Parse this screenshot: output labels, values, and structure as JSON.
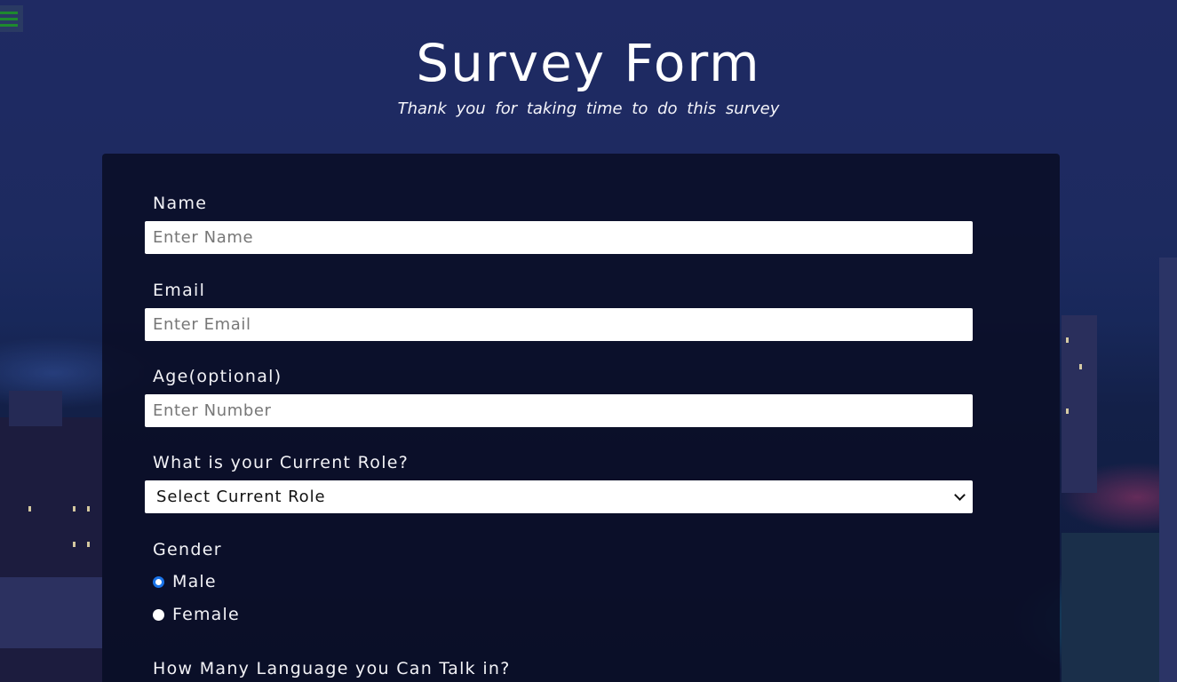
{
  "header": {
    "title": "Survey Form",
    "subtitle": "Thank you for taking time to do this survey"
  },
  "menu": {
    "icon": "hamburger-menu-icon",
    "color": "#1e8a2e"
  },
  "form": {
    "name": {
      "label": "Name",
      "placeholder": "Enter Name",
      "value": ""
    },
    "email": {
      "label": "Email",
      "placeholder": "Enter Email",
      "value": ""
    },
    "age": {
      "label": "Age(optional)",
      "placeholder": "Enter Number",
      "value": ""
    },
    "role": {
      "label": "What is your Current Role?",
      "selected": "Select Current Role"
    },
    "gender": {
      "label": "Gender",
      "options": [
        {
          "label": "Male",
          "checked": true
        },
        {
          "label": "Female",
          "checked": false
        }
      ]
    },
    "languages": {
      "label": "How Many Language you Can Talk in?"
    }
  },
  "colors": {
    "panel": "#0a0e26",
    "background": "#1d2a60",
    "radio_checked": "#1a73e8"
  }
}
